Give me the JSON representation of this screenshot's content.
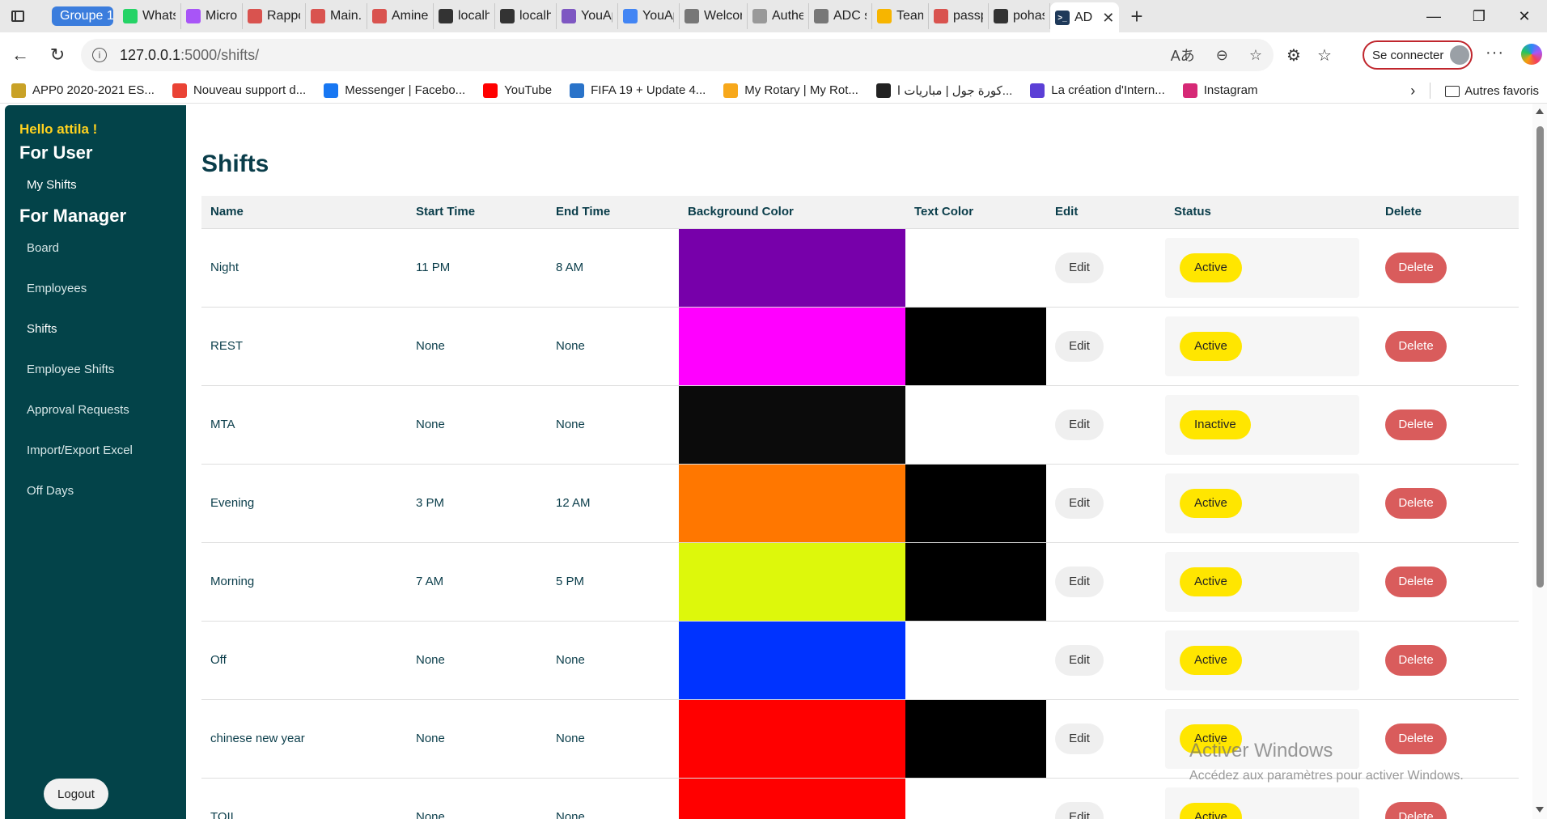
{
  "browser": {
    "group_label": "Groupe 1",
    "tabs": [
      {
        "label": "WhatsApp",
        "icon": "whatsapp-icon",
        "color": "#25d366"
      },
      {
        "label": "Microsoft",
        "icon": "copilot-icon",
        "color": "#a855f7"
      },
      {
        "label": "Rapport",
        "icon": "pdf-icon",
        "color": "#d9534f"
      },
      {
        "label": "Main.pdf",
        "icon": "pdf-icon",
        "color": "#d9534f"
      },
      {
        "label": "Amine_",
        "icon": "pdf-icon",
        "color": "#d9534f"
      },
      {
        "label": "localhost",
        "icon": "page-icon",
        "color": "#333333"
      },
      {
        "label": "localhost",
        "icon": "page-icon",
        "color": "#333333"
      },
      {
        "label": "YouApp",
        "icon": "form-icon",
        "color": "#7e57c2"
      },
      {
        "label": "YouApp",
        "icon": "doc-icon",
        "color": "#4285f4"
      },
      {
        "label": "Welcome",
        "icon": "globe-icon",
        "color": "#777777"
      },
      {
        "label": "Authent",
        "icon": "shield-icon",
        "color": "#999999"
      },
      {
        "label": "ADC sh",
        "icon": "globe-icon",
        "color": "#777777"
      },
      {
        "label": "TeamCi",
        "icon": "teamcity-icon",
        "color": "#f7b500"
      },
      {
        "label": "passpo",
        "icon": "pdf-icon",
        "color": "#d9534f"
      },
      {
        "label": "pohasa",
        "icon": "page-icon",
        "color": "#333333"
      }
    ],
    "active_tab": {
      "label": "AD",
      "icon": "terminal-icon",
      "color": "#1f3a5a"
    },
    "url_host": "127.0.0.1",
    "url_path": ":5000/shifts/",
    "signin_label": "Se connecter",
    "bookmarks": [
      {
        "label": "APP0 2020-2021 ES...",
        "icon": "app-icon",
        "color": "#c9a227"
      },
      {
        "label": "Nouveau support d...",
        "icon": "gmail-icon",
        "color": "#ea4335"
      },
      {
        "label": "Messenger | Facebo...",
        "icon": "facebook-icon",
        "color": "#1877f2"
      },
      {
        "label": "YouTube",
        "icon": "youtube-icon",
        "color": "#ff0000"
      },
      {
        "label": "FIFA 19 + Update 4...",
        "icon": "fifa-icon",
        "color": "#2a73c9"
      },
      {
        "label": "My Rotary | My Rot...",
        "icon": "rotary-icon",
        "color": "#f7a81b"
      },
      {
        "label": "كورة جول | مباريات ا...",
        "icon": "football-icon",
        "color": "#222222"
      },
      {
        "label": "La création d'Intern...",
        "icon": "bookmark-icon",
        "color": "#5b3fd6"
      },
      {
        "label": "Instagram",
        "icon": "instagram-icon",
        "color": "#d62976"
      }
    ],
    "other_favorites": "Autres favoris"
  },
  "sidebar": {
    "greeting": "Hello attila !",
    "user_heading": "For User",
    "user_items": [
      {
        "label": "My Shifts"
      }
    ],
    "manager_heading": "For Manager",
    "manager_items": [
      {
        "label": "Board"
      },
      {
        "label": "Employees"
      },
      {
        "label": "Shifts"
      },
      {
        "label": "Employee Shifts"
      },
      {
        "label": "Approval Requests"
      },
      {
        "label": "Import/Export Excel"
      },
      {
        "label": "Off Days"
      }
    ],
    "logout_label": "Logout"
  },
  "main": {
    "title": "Shifts",
    "columns": [
      "Name",
      "Start Time",
      "End Time",
      "Background Color",
      "Text Color",
      "Edit",
      "Status",
      "Delete"
    ],
    "rows": [
      {
        "name": "Night",
        "start": "11 PM",
        "end": "8 AM",
        "bg_color": "#7700aa",
        "text_color": "#ffffff",
        "edit": "Edit",
        "status": "Active",
        "delete": "Delete"
      },
      {
        "name": "REST",
        "start": "None",
        "end": "None",
        "bg_color": "#ff00ff",
        "text_color": "#000000",
        "edit": "Edit",
        "status": "Active",
        "delete": "Delete"
      },
      {
        "name": "MTA",
        "start": "None",
        "end": "None",
        "bg_color": "#0b0b0b",
        "text_color": "#ffffff",
        "edit": "Edit",
        "status": "Inactive",
        "delete": "Delete"
      },
      {
        "name": "Evening",
        "start": "3 PM",
        "end": "12 AM",
        "bg_color": "#ff7700",
        "text_color": "#000000",
        "edit": "Edit",
        "status": "Active",
        "delete": "Delete"
      },
      {
        "name": "Morning",
        "start": "7 AM",
        "end": "5 PM",
        "bg_color": "#ddf80b",
        "text_color": "#000000",
        "edit": "Edit",
        "status": "Active",
        "delete": "Delete"
      },
      {
        "name": "Off",
        "start": "None",
        "end": "None",
        "bg_color": "#0033ff",
        "text_color": "#ffffff",
        "edit": "Edit",
        "status": "Active",
        "delete": "Delete"
      },
      {
        "name": "chinese new year",
        "start": "None",
        "end": "None",
        "bg_color": "#ff0000",
        "text_color": "#000000",
        "edit": "Edit",
        "status": "Active",
        "delete": "Delete"
      },
      {
        "name": "TOIL",
        "start": "None",
        "end": "None",
        "bg_color": "#ff0000",
        "text_color": "#ffffff",
        "edit": "Edit",
        "status": "Active",
        "delete": "Delete"
      }
    ]
  },
  "watermark": {
    "line1": "Activer Windows",
    "line2": "Accédez aux paramètres pour activer Windows."
  },
  "colors": {
    "sidebar_bg": "#034349",
    "greeting": "#ffd21f",
    "status_active": "#ffe600",
    "delete_button": "#d95c5c"
  }
}
